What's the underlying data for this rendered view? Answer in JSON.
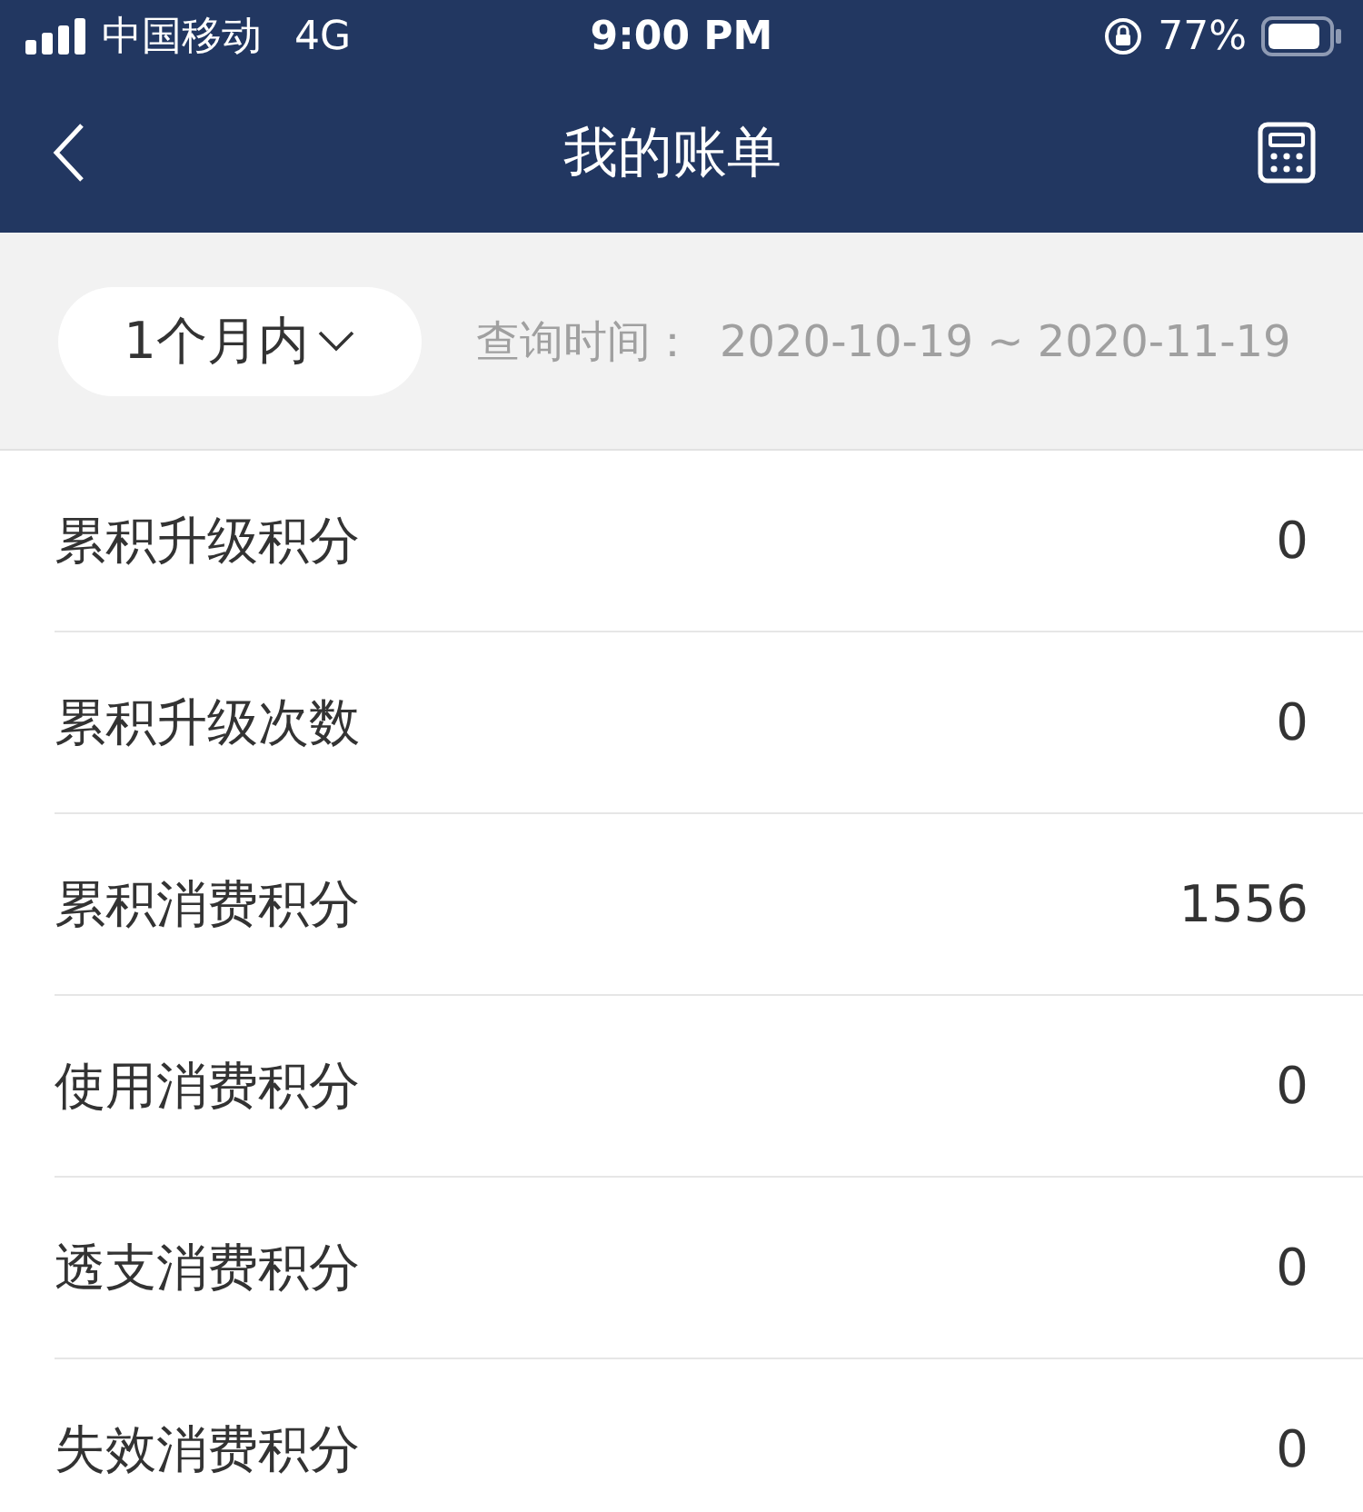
{
  "status_bar": {
    "carrier": "中国移动",
    "network": "4G",
    "time": "9:00 PM",
    "battery": "77%"
  },
  "nav": {
    "title": "我的账单"
  },
  "filter": {
    "period": "1个月内",
    "query_label": "查询时间：",
    "range": "2020-10-19 ~ 2020-11-19"
  },
  "rows": [
    {
      "label": "累积升级积分",
      "value": "0"
    },
    {
      "label": "累积升级次数",
      "value": "0"
    },
    {
      "label": "累积消费积分",
      "value": "1556"
    },
    {
      "label": "使用消费积分",
      "value": "0"
    },
    {
      "label": "透支消费积分",
      "value": "0"
    },
    {
      "label": "失效消费积分",
      "value": "0"
    }
  ]
}
